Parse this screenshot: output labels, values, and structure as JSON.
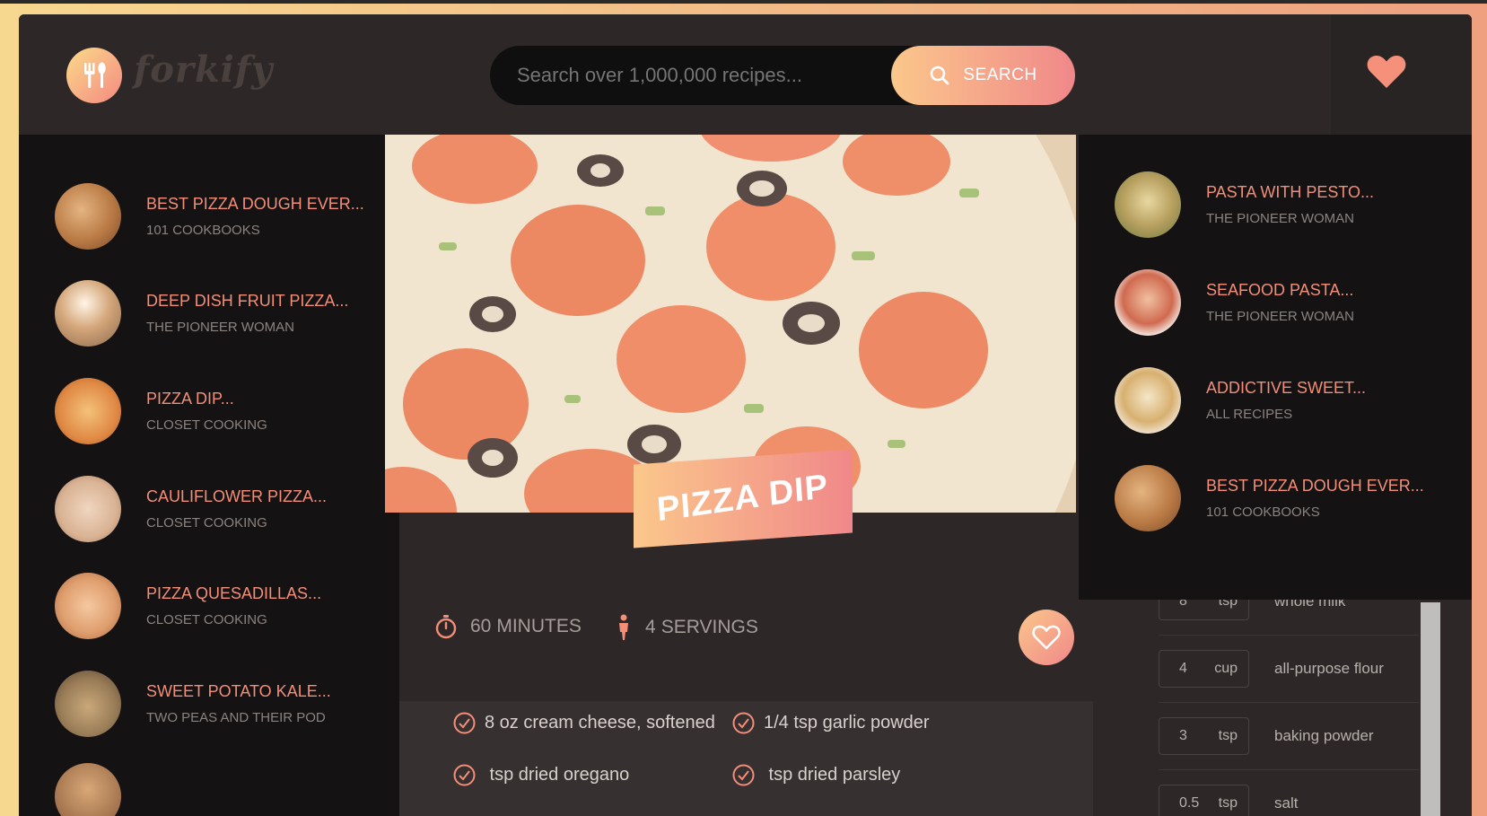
{
  "header": {
    "logo_text": "forkify",
    "search_placeholder": "Search over 1,000,000 recipes...",
    "search_label": "SEARCH"
  },
  "results": [
    {
      "title": "BEST PIZZA DOUGH EVER...",
      "publisher": "101 COOKBOOKS",
      "thumb_color": "#b97a45"
    },
    {
      "title": "DEEP DISH FRUIT PIZZA...",
      "publisher": "THE PIONEER WOMAN",
      "thumb_color": "#c8a078"
    },
    {
      "title": "PIZZA DIP...",
      "publisher": "CLOSET COOKING",
      "thumb_color": "#e08a45"
    },
    {
      "title": "CAULIFLOWER PIZZA...",
      "publisher": "CLOSET COOKING",
      "thumb_color": "#d9b394"
    },
    {
      "title": "PIZZA QUESADILLAS...",
      "publisher": "CLOSET COOKING",
      "thumb_color": "#e0a070"
    },
    {
      "title": "SWEET POTATO KALE...",
      "publisher": "TWO PEAS AND THEIR POD",
      "thumb_color": "#9a7d58"
    }
  ],
  "recipe": {
    "title": "PIZZA DIP",
    "time": "60",
    "time_unit": "MINUTES",
    "servings": "4",
    "servings_unit": "SERVINGS",
    "ingredients": [
      "8 oz cream cheese, softened",
      "1/4 tsp garlic powder",
      " tsp dried oregano",
      " tsp dried parsley"
    ]
  },
  "shopping_list": [
    {
      "qty": "8",
      "unit": "tsp",
      "item": "whole milk"
    },
    {
      "qty": "4",
      "unit": "cup",
      "item": "all-purpose flour"
    },
    {
      "qty": "3",
      "unit": "tsp",
      "item": "baking powder"
    },
    {
      "qty": "0.5",
      "unit": "tsp",
      "item": "salt"
    }
  ],
  "likes": [
    {
      "title": "PASTA WITH PESTO...",
      "publisher": "THE PIONEER WOMAN",
      "thumb_color": "#b8a060"
    },
    {
      "title": "SEAFOOD PASTA...",
      "publisher": "THE PIONEER WOMAN",
      "thumb_color": "#d06a50"
    },
    {
      "title": "ADDICTIVE SWEET...",
      "publisher": "ALL RECIPES",
      "thumb_color": "#d8b070"
    },
    {
      "title": "BEST PIZZA DOUGH EVER...",
      "publisher": "101 COOKBOOKS",
      "thumb_color": "#b97a45"
    }
  ],
  "colors": {
    "accent": "#f38e79",
    "gradient_start": "#fbc78b",
    "gradient_end": "#f0888a",
    "panel_dark": "#141212",
    "app_bg": "#2d2827"
  }
}
